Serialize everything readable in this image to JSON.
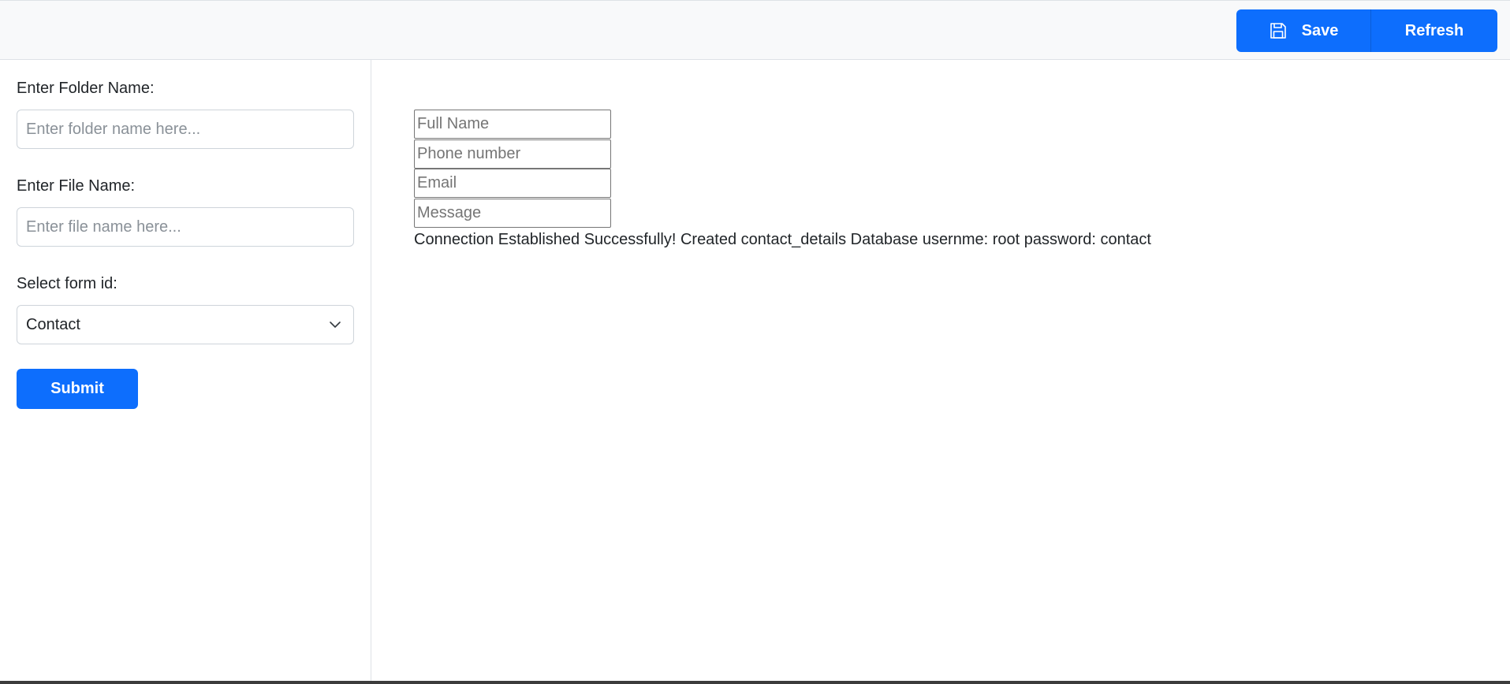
{
  "toolbar": {
    "save_label": "Save",
    "refresh_label": "Refresh",
    "accent_color": "#0d6efd",
    "save_icon": "floppy-disk-icon"
  },
  "sidebar": {
    "folder_label": "Enter Folder Name:",
    "folder_placeholder": "Enter folder name here...",
    "folder_value": "",
    "file_label": "Enter File Name:",
    "file_placeholder": "Enter file name here...",
    "file_value": "",
    "form_id_label": "Select form id:",
    "form_id_selected": "Contact",
    "form_id_icon": "chevron-down-icon",
    "submit_label": "Submit"
  },
  "main": {
    "form_fields": [
      {
        "placeholder": "Full Name"
      },
      {
        "placeholder": "Phone number"
      },
      {
        "placeholder": "Email"
      },
      {
        "placeholder": "Message"
      }
    ],
    "status_message": "Connection Established Successfully! Created contact_details Database usernme: root password: contact"
  }
}
